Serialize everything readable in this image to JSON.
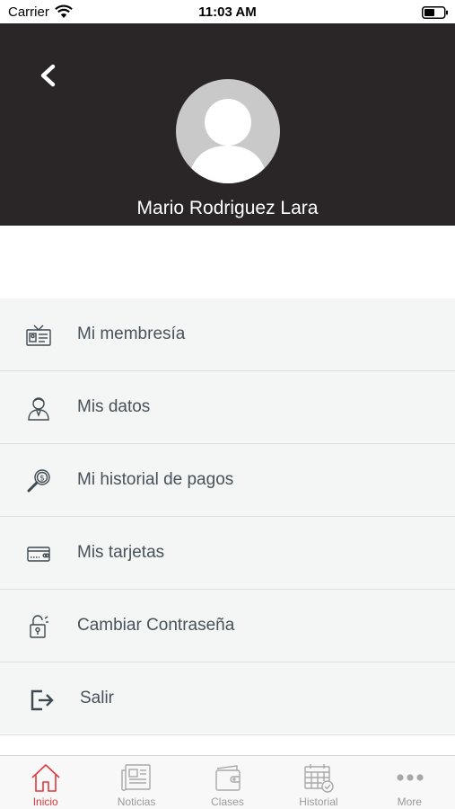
{
  "status_bar": {
    "carrier": "Carrier",
    "time": "11:03 AM",
    "wifi_icon": "wifi-icon",
    "battery_icon": "battery-icon"
  },
  "header": {
    "back_icon": "chevron-left-icon",
    "avatar_icon": "user-placeholder-icon",
    "user_name": "Mario Rodriguez Lara",
    "background_color": "#2a2627"
  },
  "menu": {
    "items": [
      {
        "label": "Mi membresía",
        "icon": "membership-card-icon"
      },
      {
        "label": "Mis datos",
        "icon": "person-icon"
      },
      {
        "label": "Mi historial de pagos",
        "icon": "payment-search-icon"
      },
      {
        "label": "Mis tarjetas",
        "icon": "credit-card-icon"
      },
      {
        "label": "Cambiar Contraseña",
        "icon": "padlock-icon"
      },
      {
        "label": "Salir",
        "icon": "logout-icon"
      }
    ]
  },
  "tab_bar": {
    "active_color": "#e0393e",
    "inactive_color": "#9a9a9a",
    "tabs": [
      {
        "label": "Inicio",
        "icon": "home-icon",
        "active": true
      },
      {
        "label": "Noticias",
        "icon": "newspaper-icon",
        "active": false
      },
      {
        "label": "Clases",
        "icon": "wallet-icon",
        "active": false
      },
      {
        "label": "Historial",
        "icon": "calendar-check-icon",
        "active": false
      },
      {
        "label": "More",
        "icon": "more-dots-icon",
        "active": false
      }
    ]
  }
}
